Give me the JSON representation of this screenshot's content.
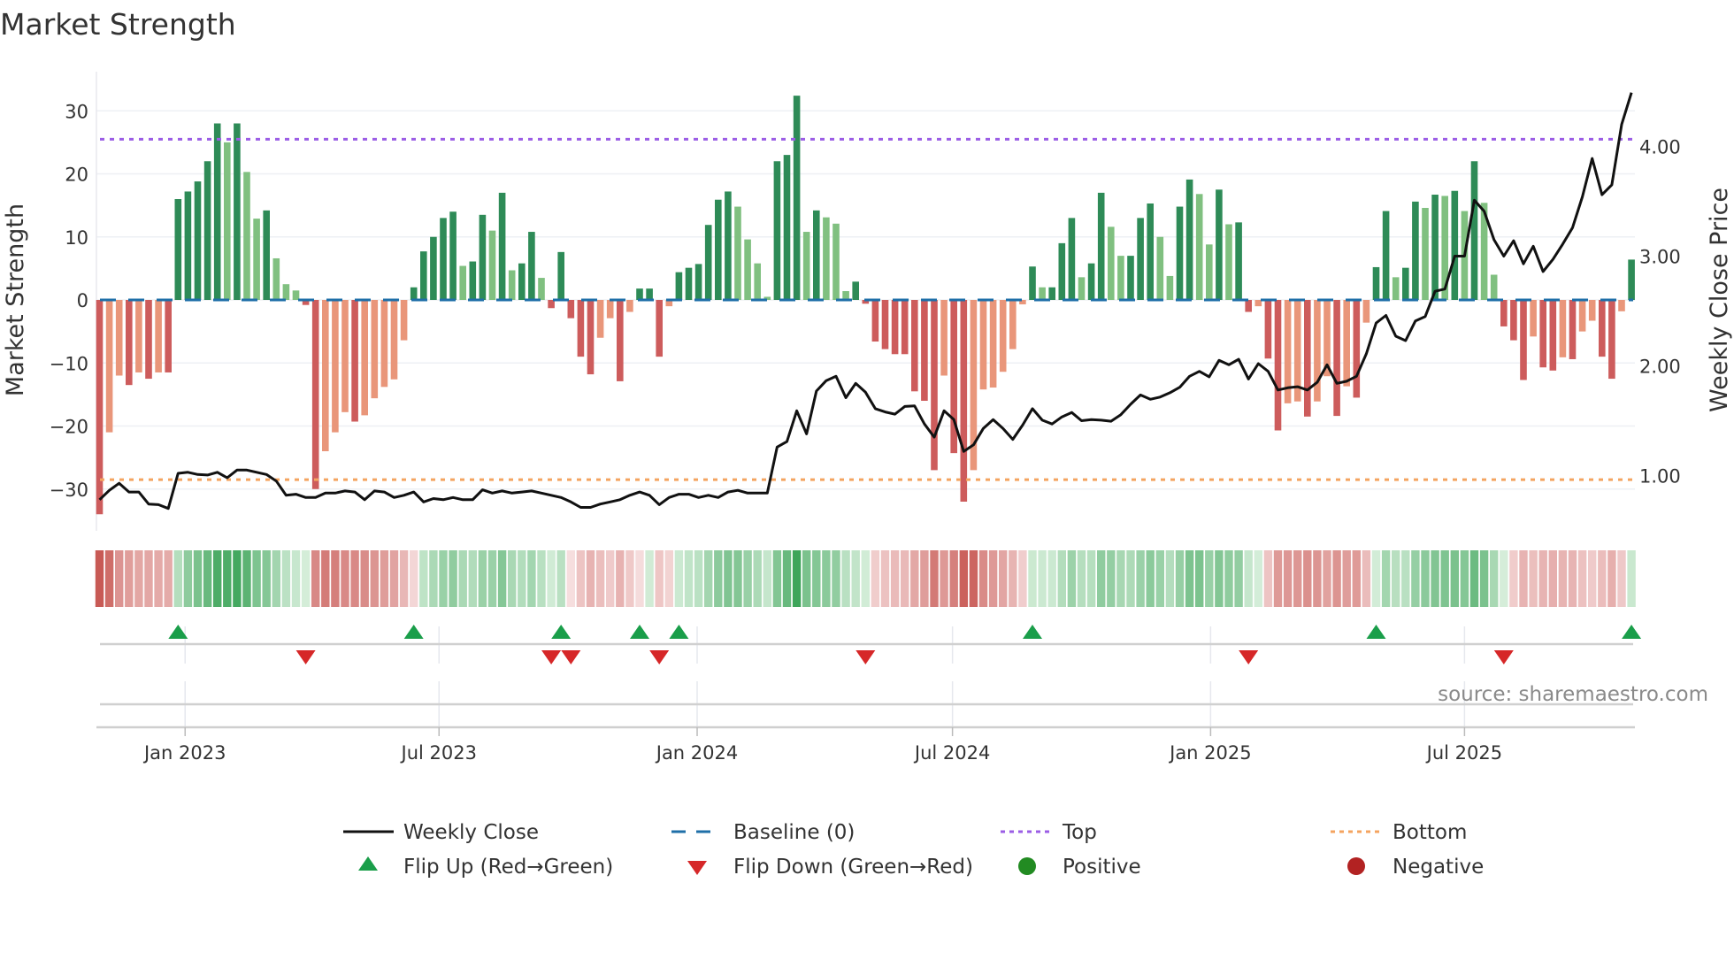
{
  "title": "Market Strength",
  "source": "source: sharemaestro.com",
  "legend": {
    "weekly_close": "Weekly Close",
    "baseline": "Baseline (0)",
    "top": "Top",
    "bottom": "Bottom",
    "flip_up": "Flip Up (Red→Green)",
    "flip_down": "Flip Down (Green→Red)",
    "positive": "Positive",
    "negative": "Negative"
  },
  "colors": {
    "pos_strong": "#2e8b57",
    "pos_weak": "#80c080",
    "neg_strong": "#cd5c5c",
    "neg_weak": "#e9967a",
    "baseline": "#1f6fa8",
    "top": "#9b5de5",
    "bottom": "#f4a460",
    "price": "#111111",
    "flip_up": "#1a9e4a",
    "flip_down": "#d62728",
    "positive": "#228b22",
    "negative": "#b22222"
  },
  "chart_data": {
    "type": "bar+line",
    "title": "Market Strength",
    "ylabel": "Market Strength",
    "y2label": "Weekly Close Price",
    "ylim": [
      -36,
      36
    ],
    "y2lim": [
      0.55,
      4.65
    ],
    "yticks": [
      -30,
      -20,
      -10,
      0,
      10,
      20,
      30
    ],
    "ytick_labels": [
      "−30",
      "−20",
      "−10",
      "0",
      "10",
      "20",
      "30"
    ],
    "y2ticks": [
      1,
      2,
      3,
      4
    ],
    "y2tick_labels": [
      "1.00",
      "2.00",
      "3.00",
      "4.00"
    ],
    "xticks": [
      {
        "date": "2023-01-01",
        "label": "Jan 2023"
      },
      {
        "date": "2023-07-01",
        "label": "Jul 2023"
      },
      {
        "date": "2024-01-01",
        "label": "Jan 2024"
      },
      {
        "date": "2024-07-01",
        "label": "Jul 2024"
      },
      {
        "date": "2025-01-01",
        "label": "Jan 2025"
      },
      {
        "date": "2025-07-01",
        "label": "Jul 2025"
      }
    ],
    "first_week": "2022-11-01",
    "week_days": 7,
    "top_level": 25.5,
    "bottom_level": -28.5,
    "baseline": 0,
    "strength": [
      -34,
      -21,
      -12,
      -13.5,
      -11.5,
      -12.5,
      -11.5,
      -11.5,
      16,
      17.2,
      18.8,
      22,
      28,
      25,
      28,
      20.3,
      12.9,
      14.2,
      6.6,
      2.5,
      1.5,
      -0.8,
      -30,
      -24,
      -21,
      -17.8,
      -19.3,
      -18.3,
      -15.6,
      -13.8,
      -12.6,
      -6.4,
      2,
      7.7,
      10,
      13,
      14,
      5.4,
      6.1,
      13.5,
      11,
      17,
      4.7,
      5.8,
      10.8,
      3.5,
      -1.3,
      7.6,
      -2.9,
      -9,
      -11.8,
      -6,
      -2.9,
      -12.9,
      -1.9,
      1.8,
      1.8,
      -9,
      -1,
      4.4,
      5.1,
      5.7,
      11.9,
      15.9,
      17.2,
      14.8,
      9.6,
      5.8,
      0.5,
      22,
      23,
      32.4,
      10.8,
      14.2,
      13.1,
      12.1,
      1.4,
      2.9,
      -0.6,
      -6.6,
      -7.8,
      -8.6,
      -8.6,
      -14.5,
      -16,
      -27,
      -12,
      -24.3,
      -32,
      -27,
      -14.2,
      -13.9,
      -11.4,
      -7.8,
      -0.7,
      5.3,
      2,
      2,
      9,
      13,
      3.6,
      5.8,
      17,
      11.6,
      7,
      7,
      13,
      15.3,
      10,
      3.8,
      14.8,
      19.1,
      16.8,
      8.8,
      17.5,
      12,
      12.3,
      -1.9,
      -1,
      -9.3,
      -20.7,
      -16.4,
      -16.1,
      -18.5,
      -16.1,
      -12.1,
      -18.4,
      -13.7,
      -15.5,
      -3.6,
      5.2,
      14.1,
      3.6,
      5.1,
      15.6,
      14.6,
      16.7,
      16.5,
      17.3,
      14.1,
      22,
      15.4,
      4,
      -4.2,
      -6.4,
      -12.7,
      -5.8,
      -10.7,
      -11.2,
      -9.1,
      -9.4,
      -5,
      -3.3,
      -9,
      -12.5,
      -1.8,
      6.4
    ],
    "weekly_close": [
      0.78,
      0.865,
      0.93,
      0.85,
      0.85,
      0.74,
      0.735,
      0.7,
      1.02,
      1.03,
      1.01,
      1.005,
      1.03,
      0.98,
      1.05,
      1.05,
      1.03,
      1.01,
      0.95,
      0.82,
      0.83,
      0.8,
      0.8,
      0.84,
      0.84,
      0.86,
      0.85,
      0.78,
      0.86,
      0.85,
      0.8,
      0.82,
      0.85,
      0.76,
      0.79,
      0.78,
      0.8,
      0.78,
      0.78,
      0.87,
      0.84,
      0.86,
      0.84,
      0.85,
      0.86,
      0.84,
      0.82,
      0.8,
      0.76,
      0.71,
      0.71,
      0.74,
      0.76,
      0.78,
      0.82,
      0.85,
      0.82,
      0.735,
      0.8,
      0.83,
      0.83,
      0.8,
      0.82,
      0.8,
      0.85,
      0.865,
      0.84,
      0.84,
      0.84,
      1.26,
      1.31,
      1.59,
      1.38,
      1.77,
      1.865,
      1.905,
      1.71,
      1.84,
      1.76,
      1.61,
      1.58,
      1.56,
      1.63,
      1.635,
      1.47,
      1.35,
      1.59,
      1.51,
      1.22,
      1.28,
      1.43,
      1.51,
      1.43,
      1.33,
      1.46,
      1.61,
      1.505,
      1.47,
      1.535,
      1.575,
      1.5,
      1.51,
      1.505,
      1.495,
      1.555,
      1.65,
      1.735,
      1.695,
      1.715,
      1.755,
      1.805,
      1.905,
      1.95,
      1.9,
      2.05,
      2.01,
      2.06,
      1.88,
      2.02,
      1.95,
      1.78,
      1.8,
      1.81,
      1.78,
      1.85,
      2.01,
      1.84,
      1.86,
      1.905,
      2.11,
      2.39,
      2.46,
      2.27,
      2.23,
      2.41,
      2.45,
      2.68,
      2.7,
      3.0,
      3.0,
      3.51,
      3.41,
      3.15,
      3.0,
      3.14,
      2.93,
      3.09,
      2.86,
      2.97,
      3.11,
      3.26,
      3.54,
      3.89,
      3.56,
      3.65,
      4.2,
      4.49
    ],
    "flip_up_weeks": [
      8,
      32,
      47,
      55,
      59,
      95,
      130,
      156
    ],
    "flip_down_weeks": [
      21,
      46,
      48,
      57,
      78,
      117,
      143
    ]
  }
}
